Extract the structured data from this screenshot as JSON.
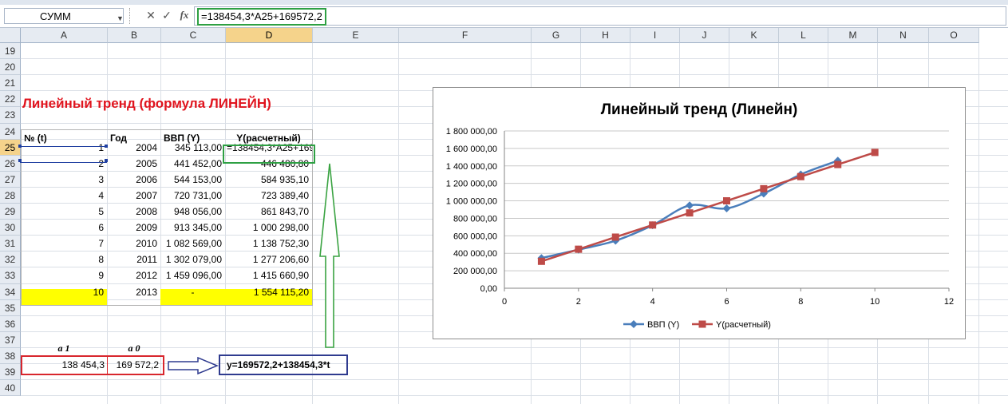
{
  "formula_bar": {
    "name_box": "СУММ",
    "cancel_icon": "✕",
    "enter_icon": "✓",
    "fx_label": "fx",
    "formula": "=138454,3*A25+169572,2"
  },
  "columns": [
    "A",
    "B",
    "C",
    "D",
    "E",
    "F",
    "G",
    "H",
    "I",
    "J",
    "K",
    "L",
    "M",
    "N",
    "O"
  ],
  "active_column": "D",
  "rows": [
    "19",
    "20",
    "21",
    "22",
    "23",
    "24",
    "25",
    "26",
    "27",
    "28",
    "29",
    "30",
    "31",
    "32",
    "33",
    "34",
    "35",
    "36",
    "37",
    "38",
    "39",
    "40"
  ],
  "active_row": "25",
  "sheet": {
    "title": "Линейный тренд (формула ЛИНЕЙН)",
    "headers": {
      "t": "№ (t)",
      "year": "Год",
      "gdp": "ВВП (Y)",
      "calc": "Y(расчетный)"
    },
    "table": [
      {
        "t": "1",
        "year": "2004",
        "gdp": "345 113,00",
        "calc": "=138454,3*A25+169572,2"
      },
      {
        "t": "2",
        "year": "2005",
        "gdp": "441 452,00",
        "calc": "446 480,80"
      },
      {
        "t": "3",
        "year": "2006",
        "gdp": "544 153,00",
        "calc": "584 935,10"
      },
      {
        "t": "4",
        "year": "2007",
        "gdp": "720 731,00",
        "calc": "723 389,40"
      },
      {
        "t": "5",
        "year": "2008",
        "gdp": "948 056,00",
        "calc": "861 843,70"
      },
      {
        "t": "6",
        "year": "2009",
        "gdp": "913 345,00",
        "calc": "1 000 298,00"
      },
      {
        "t": "7",
        "year": "2010",
        "gdp": "1 082 569,00",
        "calc": "1 138 752,30"
      },
      {
        "t": "8",
        "year": "2011",
        "gdp": "1 302 079,00",
        "calc": "1 277 206,60"
      },
      {
        "t": "9",
        "year": "2012",
        "gdp": "1 459 096,00",
        "calc": "1 415 660,90"
      },
      {
        "t": "10",
        "year": "2013",
        "gdp": "-",
        "calc": "1 554 115,20"
      }
    ],
    "coef_label_a1": "a 1",
    "coef_label_a0": "a 0",
    "a1_value": "138 454,3",
    "a0_value": "169 572,2",
    "equation": "y=169572,2+138454,3*t"
  },
  "chart_data": {
    "type": "line",
    "title": "Линейный тренд (Линейн)",
    "x": [
      1,
      2,
      3,
      4,
      5,
      6,
      7,
      8,
      9,
      10
    ],
    "series": [
      {
        "name": "ВВП (Y)",
        "color": "#4a7ebb",
        "marker": "diamond",
        "values": [
          345113,
          441452,
          544153,
          720731,
          948056,
          913345,
          1082569,
          1302079,
          1459096,
          null
        ]
      },
      {
        "name": "Y(расчетный)",
        "color": "#be4b48",
        "marker": "square",
        "values": [
          308026.5,
          446480.8,
          584935.1,
          723389.4,
          861843.7,
          1000298,
          1138752.3,
          1277206.6,
          1415660.9,
          1554115.2
        ]
      }
    ],
    "xlim": [
      0,
      12
    ],
    "ylim": [
      0,
      1800000
    ],
    "x_ticks": [
      "0",
      "2",
      "4",
      "6",
      "8",
      "10",
      "12"
    ],
    "y_ticks": [
      "0,00",
      "200 000,00",
      "400 000,00",
      "600 000,00",
      "800 000,00",
      "1 000 000,00",
      "1 200 000,00",
      "1 400 000,00",
      "1 600 000,00",
      "1 800 000,00"
    ],
    "grid": true,
    "legend": "bottom"
  }
}
